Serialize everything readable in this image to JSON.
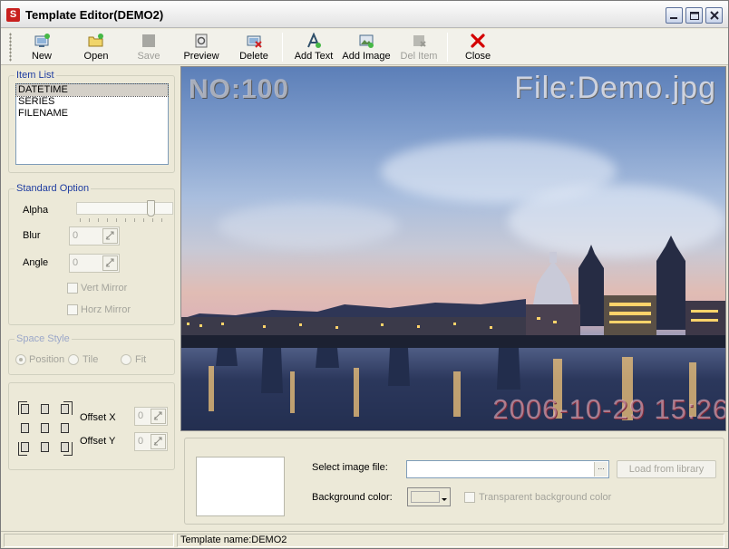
{
  "window": {
    "title": "Template Editor(DEMO2)"
  },
  "toolbar": {
    "buttons": [
      {
        "label": "New",
        "icon": "new-icon",
        "enabled": true
      },
      {
        "label": "Open",
        "icon": "open-folder-icon",
        "enabled": true
      },
      {
        "label": "Save",
        "icon": "save-icon",
        "enabled": false
      },
      {
        "label": "Preview",
        "icon": "preview-icon",
        "enabled": true
      },
      {
        "label": "Delete",
        "icon": "delete-icon",
        "enabled": true
      },
      {
        "label": "Add Text",
        "icon": "add-text-icon",
        "enabled": true
      },
      {
        "label": "Add Image",
        "icon": "add-image-icon",
        "enabled": true
      },
      {
        "label": "Del Item",
        "icon": "del-item-icon",
        "enabled": false
      },
      {
        "label": "Close",
        "icon": "close-x-icon",
        "enabled": true
      }
    ]
  },
  "item_list": {
    "title": "Item List",
    "items": [
      "DATETIME",
      "SERIES",
      "FILENAME"
    ],
    "selected": "DATETIME"
  },
  "standard_option": {
    "title": "Standard Option",
    "alpha_label": "Alpha",
    "alpha_level": 0.8,
    "blur_label": "Blur",
    "blur_value": "0",
    "angle_label": "Angle",
    "angle_value": "0",
    "vert_mirror_label": "Vert Mirror",
    "horz_mirror_label": "Horz Mirror"
  },
  "space_style": {
    "title": "Space Style",
    "options": [
      "Position",
      "Tile",
      "Fit"
    ],
    "selected": "Position"
  },
  "position": {
    "offset_x_label": "Offset X",
    "offset_x_value": "0",
    "offset_y_label": "Offset Y",
    "offset_y_value": "0"
  },
  "preview": {
    "overlay_series": "NO:100",
    "overlay_filename": "File:Demo.jpg",
    "overlay_datetime": "2006-10-29 15:26"
  },
  "image_panel": {
    "select_label": "Select image file:",
    "select_value": "",
    "browse_label": "...",
    "load_button_label": "Load from library",
    "bg_color_label": "Background color:",
    "transparent_label": "Transparent background color"
  },
  "status": {
    "left": "",
    "template_name": "Template name:DEMO2"
  },
  "colors": {
    "group_title": "#1e3ca0",
    "close_icon": "#d40000",
    "overlay_datetime": "#e6bccd"
  }
}
